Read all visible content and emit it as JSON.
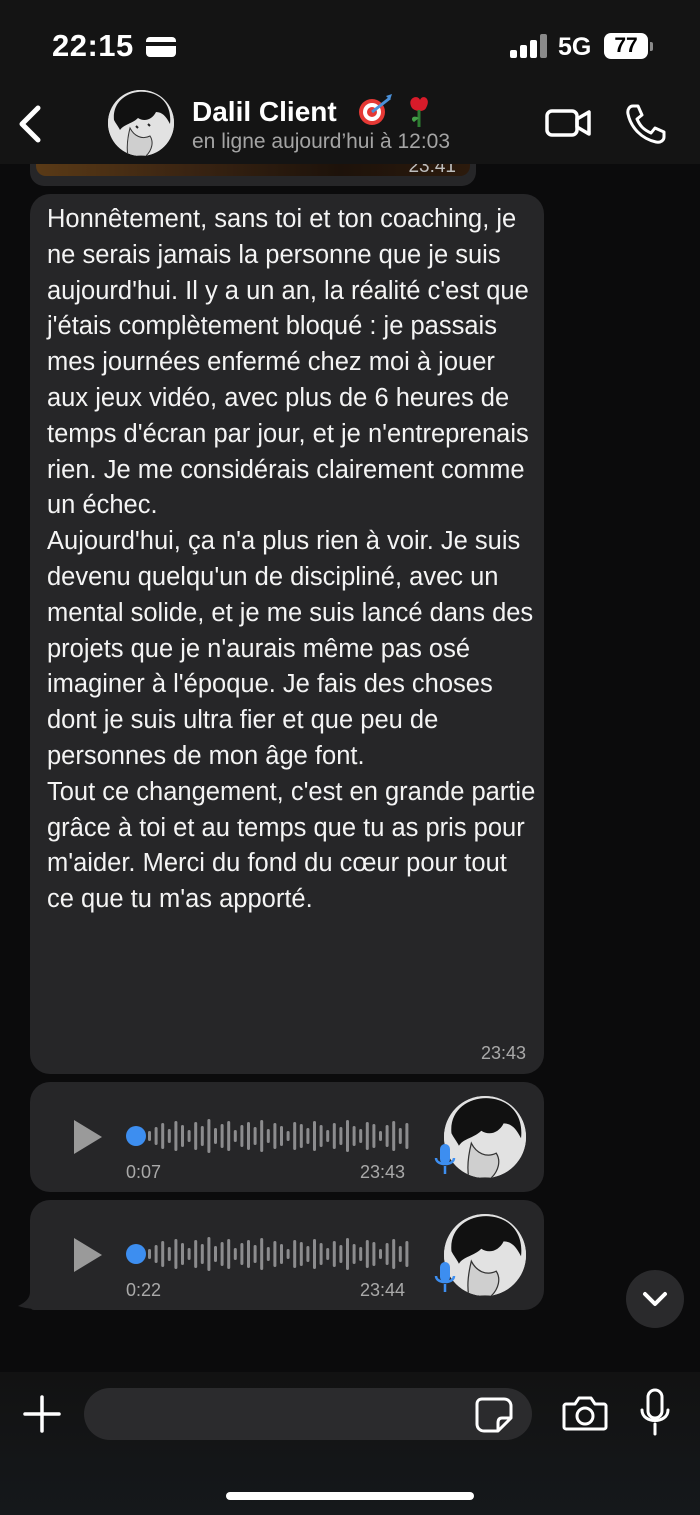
{
  "status_bar": {
    "time": "22:15",
    "network": "5G",
    "battery": "77"
  },
  "header": {
    "back_icon": "chevron-left-icon",
    "contact_name": "Dalil Client",
    "contact_emoji": "🎯🌹",
    "contact_status": "en ligne aujourd’hui à 12:03",
    "video_icon": "video-camera-icon",
    "call_icon": "phone-icon"
  },
  "chat": {
    "previous_media_time": "23:41",
    "message": {
      "text": "Honnêtement, sans toi et ton coaching, je ne serais jamais la personne que je suis aujourd'hui. Il y a un an, la réalité c'est que j'étais complètement bloqué : je passais mes journées enfermé chez moi à jouer aux jeux vidéo, avec plus de 6 heures de temps d'écran par jour, et je n'entreprenais rien. Je me considérais clairement comme un échec.\nAujourd'hui, ça n'a plus rien à voir. Je suis devenu quelqu'un de discipliné, avec un mental solide, et je me suis lancé dans des projets que je n'aurais même pas osé imaginer à l'époque. Je fais des choses dont je suis ultra fier et que peu de personnes de mon âge font.\nTout ce changement, c'est en grande partie grâce à toi et au temps que tu as pris pour m'aider. Merci du fond du cœur pour tout ce que tu m'as apporté.",
      "time": "23:43"
    },
    "voice_messages": [
      {
        "duration": "0:07",
        "time": "23:43",
        "progress": 0
      },
      {
        "duration": "0:22",
        "time": "23:44",
        "progress": 0
      }
    ]
  },
  "composer": {
    "input_value": "",
    "plus_icon": "plus-icon",
    "sticker_icon": "sticker-icon",
    "camera_icon": "camera-icon",
    "mic_icon": "microphone-icon"
  },
  "colors": {
    "background": "#0b0b0c",
    "bubble": "#262628",
    "accent_blue": "#3d8ef0",
    "secondary_text": "#a9a9a9"
  }
}
